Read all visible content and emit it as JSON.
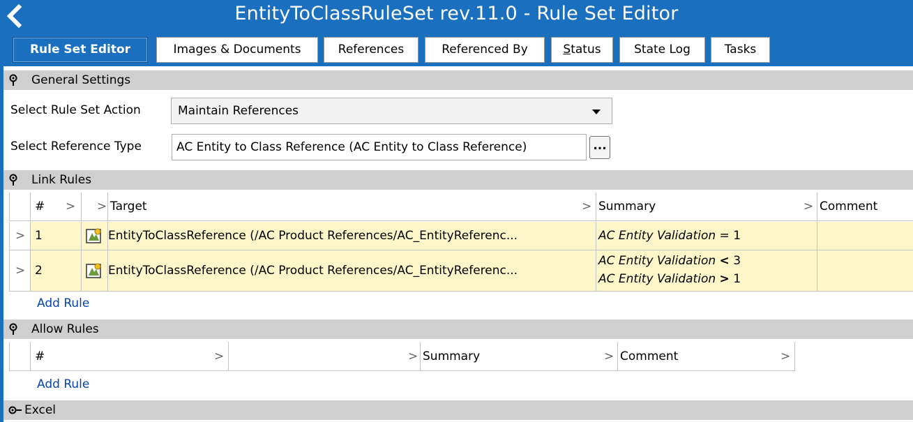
{
  "header": {
    "title": "EntityToClassRuleSet rev.11.0 - Rule Set Editor"
  },
  "tabs": [
    {
      "label": "Rule Set Editor",
      "active": true
    },
    {
      "label": "Images & Documents"
    },
    {
      "label": "References"
    },
    {
      "label": "Referenced By"
    },
    {
      "label_ul": "S",
      "label_rest": "tatus"
    },
    {
      "label": "State Log"
    },
    {
      "label": "Tasks"
    }
  ],
  "general": {
    "title": "General Settings",
    "action_label": "Select Rule Set Action",
    "action_value": "Maintain References",
    "reftype_label": "Select Reference Type",
    "reftype_value": "AC Entity to Class Reference (AC Entity to Class Reference)",
    "dots": "..."
  },
  "link_rules": {
    "title": "Link Rules",
    "columns": {
      "num": "#",
      "target": "Target",
      "summary": "Summary",
      "comment": "Comment"
    },
    "rows": [
      {
        "num": "1",
        "target": "EntityToClassReference (/AC Product References/AC_EntityReferenc...",
        "summary": [
          {
            "attr": "AC Entity Validation",
            "op": "=",
            "val": "1"
          }
        ],
        "comment": ""
      },
      {
        "num": "2",
        "target": "EntityToClassReference (/AC Product References/AC_EntityReferenc...",
        "summary": [
          {
            "attr": "AC Entity Validation",
            "op": "<",
            "val": "3"
          },
          {
            "attr": "AC Entity Validation",
            "op": ">",
            "val": "1"
          }
        ],
        "comment": ""
      }
    ],
    "add_rule": "Add Rule"
  },
  "allow_rules": {
    "title": "Allow Rules",
    "columns": {
      "num": "#",
      "summary": "Summary",
      "comment": "Comment"
    },
    "add_rule": "Add Rule"
  },
  "excel": {
    "title": "Excel"
  },
  "colors": {
    "brand_blue": "#1a6fbf",
    "section_gray": "#cfcfcf",
    "row_highlight": "#fcf6c8",
    "link_blue": "#0645ad"
  },
  "icons": {
    "back": "chevron-left-icon",
    "pin": "pin-icon",
    "entity": "entity-reference-icon"
  }
}
